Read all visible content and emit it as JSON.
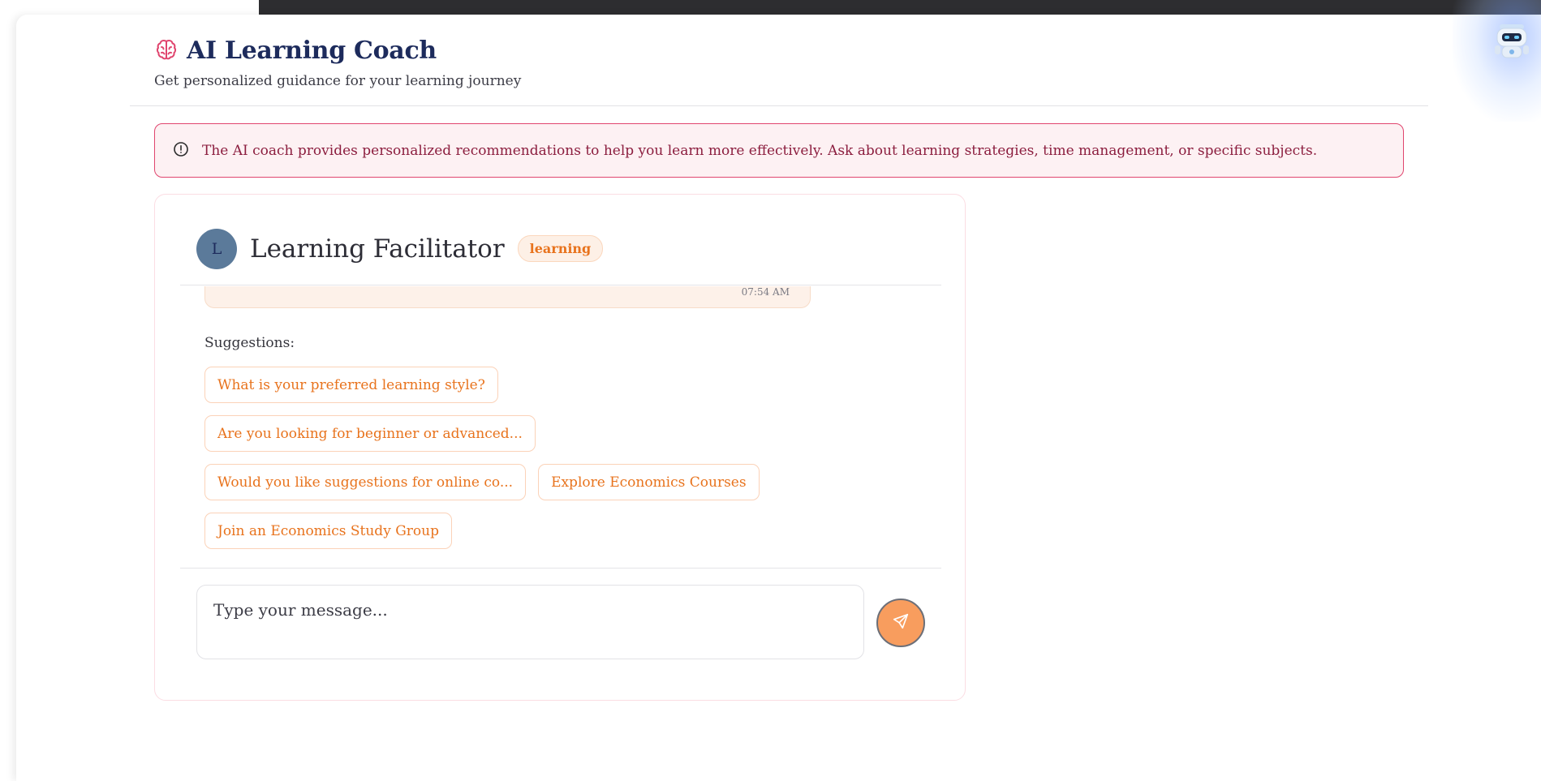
{
  "app": {
    "title": "AI Learning Coach",
    "subtitle": "Get personalized guidance for your learning journey",
    "title_icon": "brain-icon",
    "assistant_icon": "robot-icon"
  },
  "banner": {
    "icon": "alert-circle-icon",
    "text": "The AI coach provides personalized recommendations to help you learn more effectively. Ask about learning strategies, time management, or specific subjects."
  },
  "chat": {
    "avatar_initial": "L",
    "agent_name": "Learning Facilitator",
    "agent_badge": "learning",
    "message_time": "07:54 AM",
    "suggestions_label": "Suggestions:",
    "suggestions": [
      "What is your preferred learning style?",
      "Are you looking for beginner or advanced...",
      "Would you like suggestions for online co...",
      "Explore Economics Courses",
      "Join an Economics Study Group"
    ],
    "input_placeholder": "Type your message...",
    "send_icon": "send-icon"
  },
  "colors": {
    "title": "#1d2b5c",
    "accent_orange": "#e8731d",
    "banner_border": "#e0456e",
    "banner_text": "#8c1e3f",
    "send_button": "#f89d5e",
    "avatar": "#5b7a9a"
  }
}
